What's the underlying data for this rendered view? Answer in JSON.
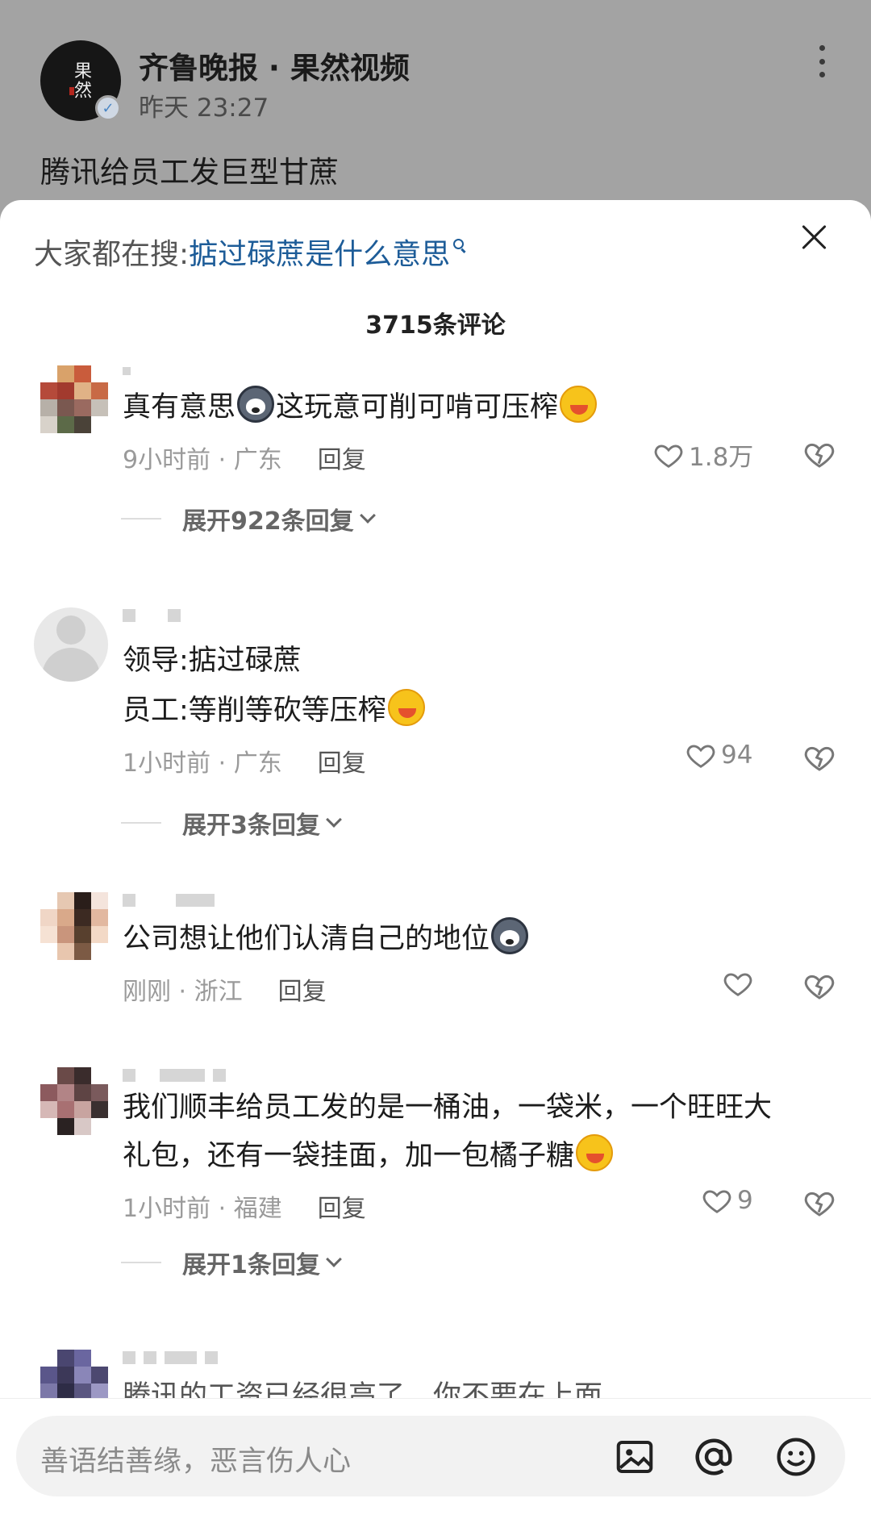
{
  "post": {
    "author": "齐鲁晚报 · 果然视频",
    "time": "昨天 23:27",
    "title": "腾讯给员工发巨型甘蔗",
    "avatar_logo": "果然"
  },
  "panel": {
    "search_prefix": "大家都在搜:",
    "search_term": "掂过碌蔗是什么意思",
    "comment_count": "3715条评论"
  },
  "comments": [
    {
      "text": "真有意思",
      "text2": "这玩意可削可啃可压榨",
      "time_loc": "9小时前 · 广东",
      "reply": "回复",
      "likes": "1.8万",
      "expand": "展开922条回复"
    },
    {
      "line1": "领导:掂过碌蔗",
      "line2": "员工:等削等砍等压榨",
      "time_loc": "1小时前 · 广东",
      "reply": "回复",
      "likes": "94",
      "expand": "展开3条回复"
    },
    {
      "text": "公司想让他们认清自己的地位",
      "time_loc": "刚刚 · 浙江",
      "reply": "回复",
      "likes": ""
    },
    {
      "line1": "我们顺丰给员工发的是一桶油，一袋米，一个旺旺大",
      "line2": "礼包，还有一袋挂面，加一包橘子糖",
      "time_loc": "1小时前 · 福建",
      "reply": "回复",
      "likes": "9",
      "expand": "展开1条回复"
    },
    {
      "partial": "腾讯的工资已经很高了，你不要在上面"
    }
  ],
  "input": {
    "placeholder": "善语结善缘，恶言伤人心"
  },
  "icons": [
    "more-icon",
    "verified-icon",
    "search-icon",
    "close-icon",
    "heart-icon",
    "dislike-icon",
    "image-icon",
    "at-icon",
    "emoji-icon"
  ],
  "colors": {
    "accent_link": "#1d5c98",
    "dim_background": "#a3a3a3"
  }
}
